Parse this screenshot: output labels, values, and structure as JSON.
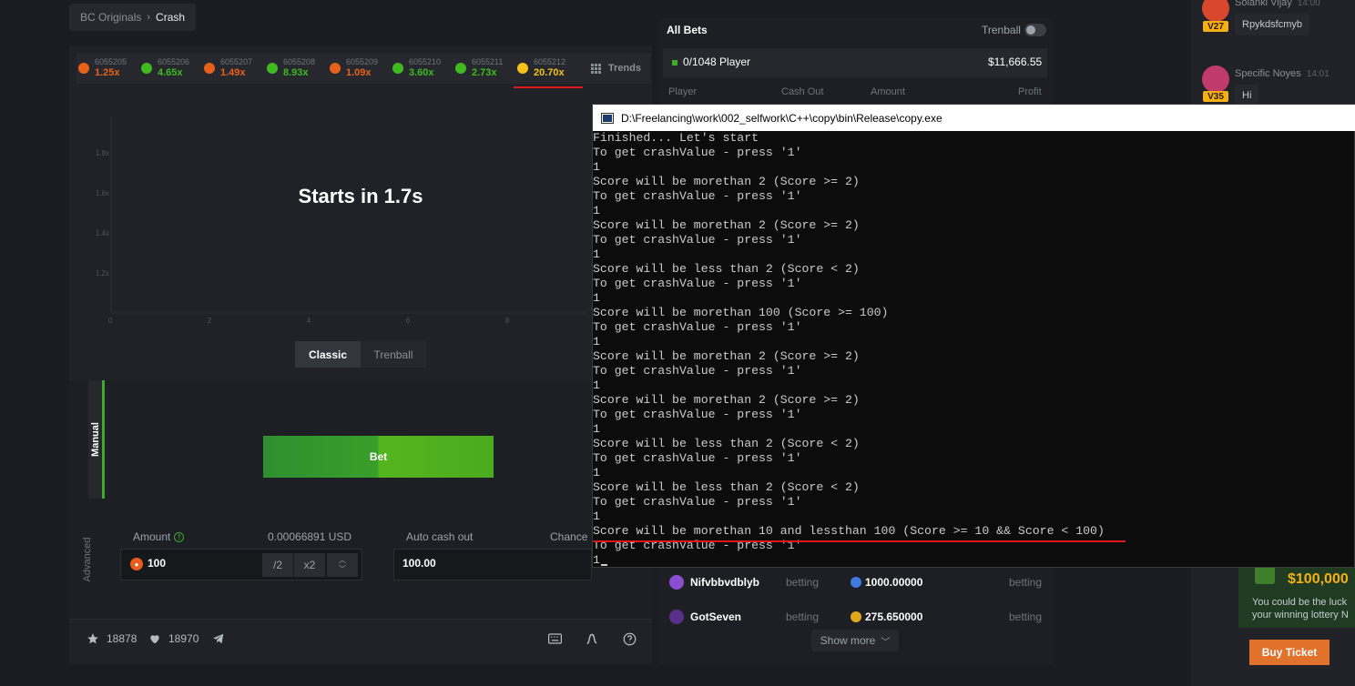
{
  "breadcrumb": {
    "parent": "BC Originals",
    "current": "Crash"
  },
  "history": [
    {
      "id": "6055205",
      "value": "1.25x",
      "color": "#e8611a"
    },
    {
      "id": "6055206",
      "value": "4.65x",
      "color": "#3fbb1f"
    },
    {
      "id": "6055207",
      "value": "1.49x",
      "color": "#e8611a"
    },
    {
      "id": "6055208",
      "value": "8.93x",
      "color": "#3fbb1f"
    },
    {
      "id": "6055209",
      "value": "1.09x",
      "color": "#e8611a"
    },
    {
      "id": "6055210",
      "value": "3.60x",
      "color": "#3fbb1f"
    },
    {
      "id": "6055211",
      "value": "2.73x",
      "color": "#3fbb1f"
    },
    {
      "id": "6055212",
      "value": "20.70x",
      "color": "#f5c21a"
    }
  ],
  "trends_label": "Trends",
  "chart": {
    "y_ticks": [
      "1.8x",
      "1.6x",
      "1.4x",
      "1.2x"
    ],
    "x_ticks": [
      "0",
      "2",
      "4",
      "6",
      "8"
    ],
    "status": "Starts in 1.7s"
  },
  "mode_tabs": {
    "classic": "Classic",
    "trenball": "Trenball"
  },
  "side_tabs": {
    "manual": "Manual",
    "advanced": "Advanced"
  },
  "bet": {
    "button": "Bet",
    "amount_label": "Amount",
    "amount_info": "!",
    "usd_value": "0.00066891 USD",
    "amount": "100",
    "half": "/2",
    "double": "x2",
    "auto_cash_out_label": "Auto cash out",
    "auto_cash_out": "100.00",
    "chance_label": "Chance",
    "chance_mark": "x"
  },
  "footer": {
    "favorites": "18878",
    "likes": "18970"
  },
  "all_bets": {
    "title": "All Bets",
    "trenball_label": "Trenball",
    "players": "0/1048 Player",
    "total": "$11,666.55",
    "columns": [
      "Player",
      "Cash Out",
      "Amount",
      "Profit"
    ],
    "rows": [
      {
        "name": "Nifvbbvdblyb",
        "status": "betting",
        "amount": "1000.00000",
        "profit": "betting",
        "coin_color": "#3d7be0",
        "avatar_color": "#8a4fd0"
      },
      {
        "name": "GotSeven",
        "status": "betting",
        "amount": "275.650000",
        "profit": "betting",
        "coin_color": "#e0a81c",
        "avatar_color": "#5a2f8a"
      }
    ],
    "show_more": "Show more"
  },
  "chat": [
    {
      "name": "Solanki Vijay",
      "time": "14:00",
      "level": "V27",
      "message": "Rpykdsfcmyb"
    },
    {
      "name": "Specific Noyes",
      "time": "14:01",
      "level": "V35",
      "message": "Hi"
    }
  ],
  "lottery": {
    "amount": "$100,000",
    "line1": "You could be the luck",
    "line2": "your winning lottery N",
    "buy": "Buy Ticket"
  },
  "console": {
    "title": "D:\\Freelancing\\work\\002_selfwork\\C++\\copy\\bin\\Release\\copy.exe",
    "lines": [
      "Finished... Let's start",
      "To get crashValue - press '1'",
      "1",
      "Score will be morethan 2 (Score >= 2)",
      "To get crashValue - press '1'",
      "1",
      "Score will be morethan 2 (Score >= 2)",
      "To get crashValue - press '1'",
      "1",
      "Score will be less than 2 (Score < 2)",
      "To get crashValue - press '1'",
      "1",
      "Score will be morethan 100 (Score >= 100)",
      "To get crashValue - press '1'",
      "1",
      "Score will be morethan 2 (Score >= 2)",
      "To get crashValue - press '1'",
      "1",
      "Score will be morethan 2 (Score >= 2)",
      "To get crashValue - press '1'",
      "1",
      "Score will be less than 2 (Score < 2)",
      "To get crashValue - press '1'",
      "1",
      "Score will be less than 2 (Score < 2)",
      "To get crashValue - press '1'",
      "1",
      "Score will be morethan 10 and lessthan 100 (Score >= 10 && Score < 100)",
      "To get crashValue - press '1'",
      "1"
    ]
  }
}
